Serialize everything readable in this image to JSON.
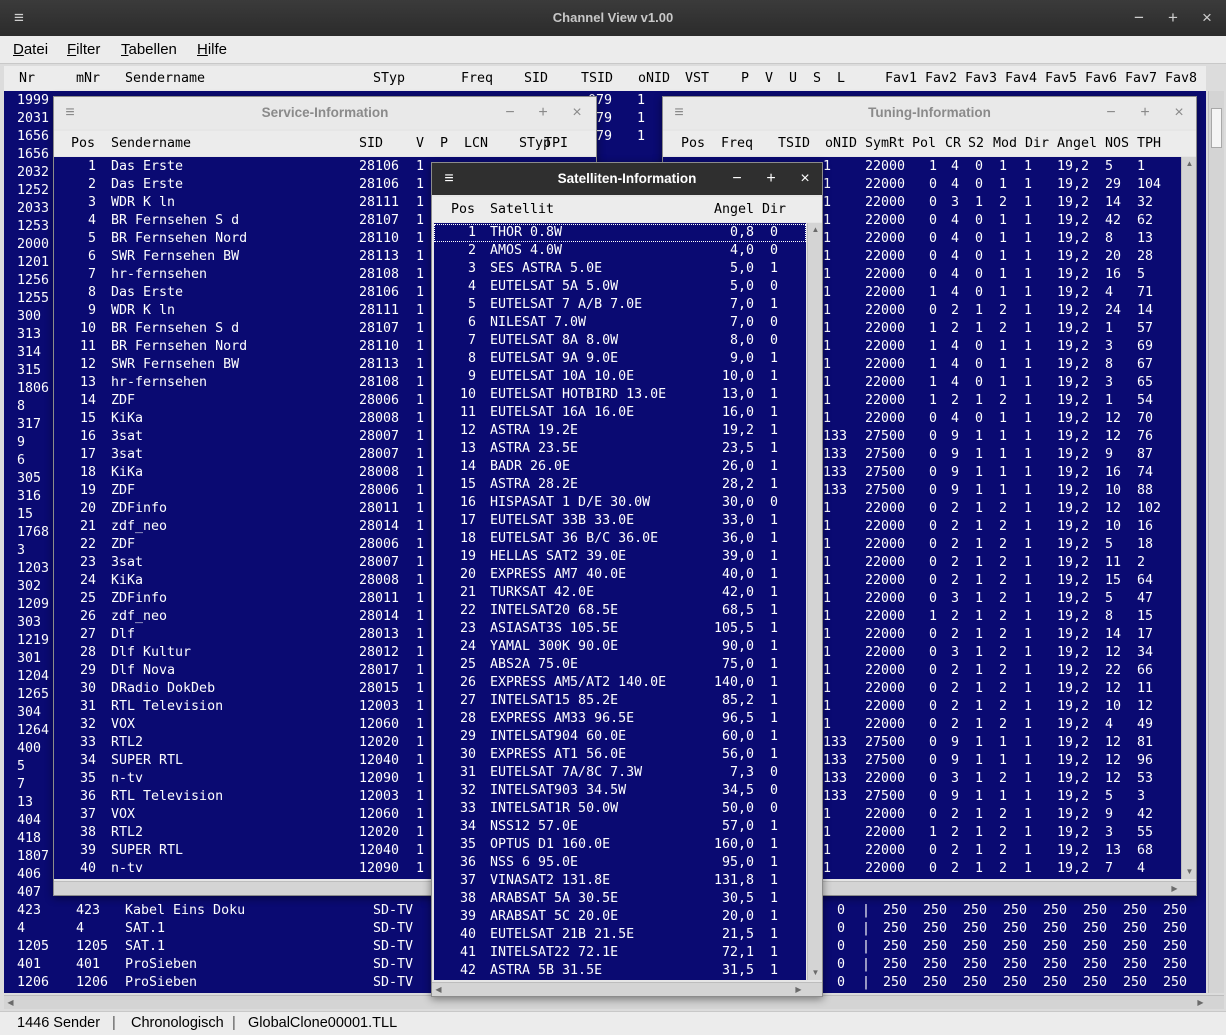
{
  "app": {
    "title": "Channel View v1.00"
  },
  "menu": [
    {
      "label": "Datei",
      "hotkey": "D"
    },
    {
      "label": "Filter",
      "hotkey": "F"
    },
    {
      "label": "Tabellen",
      "hotkey": "T"
    },
    {
      "label": "Hilfe",
      "hotkey": "H"
    }
  ],
  "main": {
    "headers": [
      "Nr",
      "mNr",
      "Sendername",
      "STyp",
      "Freq",
      "SID",
      "TSID",
      "oNID",
      "VST",
      "P",
      "V",
      "U",
      "S",
      "L",
      "Fav1",
      "Fav2",
      "Fav3",
      "Fav4",
      "Fav5",
      "Fav6",
      "Fav7",
      "Fav8"
    ],
    "left_nr": [
      "1999",
      "2031",
      "1656",
      "1656",
      "2032",
      "1252",
      "2033",
      "1253",
      "2000",
      "1201",
      "1256",
      "1255",
      "300",
      "313",
      "314",
      "315",
      "1806",
      "8",
      "317",
      "9",
      "6",
      "305",
      "316",
      "15",
      "1768",
      "3",
      "1203",
      "302",
      "1209",
      "303",
      "1219",
      "301",
      "1204",
      "1265",
      "304",
      "1264",
      "400",
      "5",
      "7",
      "13",
      "404",
      "418",
      "1807",
      "406",
      "407"
    ],
    "tsid_tail": [
      "079",
      "079",
      "079"
    ],
    "onid_tail": [
      "1",
      "1",
      "1"
    ],
    "bottom_rows": [
      {
        "nr": "423",
        "mnr": "423",
        "name": "Kabel Eins Doku",
        "styp": "SD-TV",
        "onid": "0",
        "favs": [
          "250",
          "250",
          "250",
          "250",
          "250",
          "250",
          "250",
          "250"
        ]
      },
      {
        "nr": "4",
        "mnr": "4",
        "name": "SAT.1",
        "styp": "SD-TV",
        "onid": "0",
        "favs": [
          "250",
          "250",
          "250",
          "250",
          "250",
          "250",
          "250",
          "250"
        ]
      },
      {
        "nr": "1205",
        "mnr": "1205",
        "name": "SAT.1",
        "styp": "SD-TV",
        "onid": "0",
        "favs": [
          "250",
          "250",
          "250",
          "250",
          "250",
          "250",
          "250",
          "250"
        ]
      },
      {
        "nr": "401",
        "mnr": "401",
        "name": "ProSieben",
        "styp": "SD-TV",
        "onid": "0",
        "favs": [
          "250",
          "250",
          "250",
          "250",
          "250",
          "250",
          "250",
          "250"
        ]
      },
      {
        "nr": "1206",
        "mnr": "1206",
        "name": "ProSieben",
        "styp": "SD-TV",
        "onid": "0",
        "favs": [
          "250",
          "250",
          "250",
          "250",
          "250",
          "250",
          "250",
          "250"
        ]
      }
    ]
  },
  "service": {
    "title": "Service-Information",
    "headers": [
      "Pos",
      "Sendername",
      "SID",
      "V",
      "P",
      "LCN",
      "STyp",
      "TPI"
    ],
    "rows": [
      [
        "1",
        "Das Erste",
        "28106",
        "1"
      ],
      [
        "2",
        "Das Erste",
        "28106",
        "1"
      ],
      [
        "3",
        "WDR K ln",
        "28111",
        "1"
      ],
      [
        "4",
        "BR Fernsehen S d",
        "28107",
        "1"
      ],
      [
        "5",
        "BR Fernsehen Nord",
        "28110",
        "1"
      ],
      [
        "6",
        "SWR Fernsehen BW",
        "28113",
        "1"
      ],
      [
        "7",
        "hr-fernsehen",
        "28108",
        "1"
      ],
      [
        "8",
        "Das Erste",
        "28106",
        "1"
      ],
      [
        "9",
        "WDR K ln",
        "28111",
        "1"
      ],
      [
        "10",
        "BR Fernsehen S d",
        "28107",
        "1"
      ],
      [
        "11",
        "BR Fernsehen Nord",
        "28110",
        "1"
      ],
      [
        "12",
        "SWR Fernsehen BW",
        "28113",
        "1"
      ],
      [
        "13",
        "hr-fernsehen",
        "28108",
        "1"
      ],
      [
        "14",
        "ZDF",
        "28006",
        "1"
      ],
      [
        "15",
        "KiKa",
        "28008",
        "1"
      ],
      [
        "16",
        "3sat",
        "28007",
        "1"
      ],
      [
        "17",
        "3sat",
        "28007",
        "1"
      ],
      [
        "18",
        "KiKa",
        "28008",
        "1"
      ],
      [
        "19",
        "ZDF",
        "28006",
        "1"
      ],
      [
        "20",
        "ZDFinfo",
        "28011",
        "1"
      ],
      [
        "21",
        "zdf_neo",
        "28014",
        "1"
      ],
      [
        "22",
        "ZDF",
        "28006",
        "1"
      ],
      [
        "23",
        "3sat",
        "28007",
        "1"
      ],
      [
        "24",
        "KiKa",
        "28008",
        "1"
      ],
      [
        "25",
        "ZDFinfo",
        "28011",
        "1"
      ],
      [
        "26",
        "zdf_neo",
        "28014",
        "1"
      ],
      [
        "27",
        "Dlf",
        "28013",
        "1"
      ],
      [
        "28",
        "Dlf Kultur",
        "28012",
        "1"
      ],
      [
        "29",
        "Dlf Nova",
        "28017",
        "1"
      ],
      [
        "30",
        "DRadio DokDeb",
        "28015",
        "1"
      ],
      [
        "31",
        "RTL Television",
        "12003",
        "1"
      ],
      [
        "32",
        "VOX",
        "12060",
        "1"
      ],
      [
        "33",
        "RTL2",
        "12020",
        "1"
      ],
      [
        "34",
        "SUPER RTL",
        "12040",
        "1"
      ],
      [
        "35",
        "n-tv",
        "12090",
        "1"
      ],
      [
        "36",
        "RTL Television",
        "12003",
        "1"
      ],
      [
        "37",
        "VOX",
        "12060",
        "1"
      ],
      [
        "38",
        "RTL2",
        "12020",
        "1"
      ],
      [
        "39",
        "SUPER RTL",
        "12040",
        "1"
      ],
      [
        "40",
        "n-tv",
        "12090",
        "1"
      ]
    ]
  },
  "tuning": {
    "title": "Tuning-Information",
    "headers": [
      "Pos",
      "Freq",
      "TSID",
      "oNID",
      "SymRt",
      "Pol",
      "CR",
      "S2",
      "Mod",
      "Dir",
      "Angel",
      "NOS",
      "TPH"
    ],
    "rows": [
      [
        "1",
        "22000",
        "1",
        "4",
        "0",
        "1",
        "1",
        "19,2",
        "5",
        "1"
      ],
      [
        "1",
        "22000",
        "0",
        "4",
        "0",
        "1",
        "1",
        "19,2",
        "29",
        "104"
      ],
      [
        "1",
        "22000",
        "0",
        "3",
        "1",
        "2",
        "1",
        "19,2",
        "14",
        "32"
      ],
      [
        "1",
        "22000",
        "0",
        "4",
        "0",
        "1",
        "1",
        "19,2",
        "42",
        "62"
      ],
      [
        "1",
        "22000",
        "0",
        "4",
        "0",
        "1",
        "1",
        "19,2",
        "8",
        "13"
      ],
      [
        "1",
        "22000",
        "0",
        "4",
        "0",
        "1",
        "1",
        "19,2",
        "20",
        "28"
      ],
      [
        "1",
        "22000",
        "0",
        "4",
        "0",
        "1",
        "1",
        "19,2",
        "16",
        "5"
      ],
      [
        "1",
        "22000",
        "1",
        "4",
        "0",
        "1",
        "1",
        "19,2",
        "4",
        "71"
      ],
      [
        "1",
        "22000",
        "0",
        "2",
        "1",
        "2",
        "1",
        "19,2",
        "24",
        "14"
      ],
      [
        "1",
        "22000",
        "1",
        "2",
        "1",
        "2",
        "1",
        "19,2",
        "1",
        "57"
      ],
      [
        "1",
        "22000",
        "1",
        "4",
        "0",
        "1",
        "1",
        "19,2",
        "3",
        "69"
      ],
      [
        "1",
        "22000",
        "1",
        "4",
        "0",
        "1",
        "1",
        "19,2",
        "8",
        "67"
      ],
      [
        "1",
        "22000",
        "1",
        "4",
        "0",
        "1",
        "1",
        "19,2",
        "3",
        "65"
      ],
      [
        "1",
        "22000",
        "1",
        "2",
        "1",
        "2",
        "1",
        "19,2",
        "1",
        "54"
      ],
      [
        "1",
        "22000",
        "0",
        "4",
        "0",
        "1",
        "1",
        "19,2",
        "12",
        "70"
      ],
      [
        "133",
        "27500",
        "0",
        "9",
        "1",
        "1",
        "1",
        "19,2",
        "12",
        "76"
      ],
      [
        "133",
        "27500",
        "0",
        "9",
        "1",
        "1",
        "1",
        "19,2",
        "9",
        "87"
      ],
      [
        "133",
        "27500",
        "0",
        "9",
        "1",
        "1",
        "1",
        "19,2",
        "16",
        "74"
      ],
      [
        "133",
        "27500",
        "0",
        "9",
        "1",
        "1",
        "1",
        "19,2",
        "10",
        "88"
      ],
      [
        "1",
        "22000",
        "0",
        "2",
        "1",
        "2",
        "1",
        "19,2",
        "12",
        "102"
      ],
      [
        "1",
        "22000",
        "0",
        "2",
        "1",
        "2",
        "1",
        "19,2",
        "10",
        "16"
      ],
      [
        "1",
        "22000",
        "0",
        "2",
        "1",
        "2",
        "1",
        "19,2",
        "5",
        "18"
      ],
      [
        "1",
        "22000",
        "0",
        "2",
        "1",
        "2",
        "1",
        "19,2",
        "11",
        "2"
      ],
      [
        "1",
        "22000",
        "0",
        "2",
        "1",
        "2",
        "1",
        "19,2",
        "15",
        "64"
      ],
      [
        "1",
        "22000",
        "0",
        "3",
        "1",
        "2",
        "1",
        "19,2",
        "5",
        "47"
      ],
      [
        "1",
        "22000",
        "1",
        "2",
        "1",
        "2",
        "1",
        "19,2",
        "8",
        "15"
      ],
      [
        "1",
        "22000",
        "0",
        "2",
        "1",
        "2",
        "1",
        "19,2",
        "14",
        "17"
      ],
      [
        "1",
        "22000",
        "0",
        "3",
        "1",
        "2",
        "1",
        "19,2",
        "12",
        "34"
      ],
      [
        "1",
        "22000",
        "0",
        "2",
        "1",
        "2",
        "1",
        "19,2",
        "22",
        "66"
      ],
      [
        "1",
        "22000",
        "0",
        "2",
        "1",
        "2",
        "1",
        "19,2",
        "12",
        "11"
      ],
      [
        "1",
        "22000",
        "0",
        "2",
        "1",
        "2",
        "1",
        "19,2",
        "10",
        "12"
      ],
      [
        "1",
        "22000",
        "0",
        "2",
        "1",
        "2",
        "1",
        "19,2",
        "4",
        "49"
      ],
      [
        "133",
        "27500",
        "0",
        "9",
        "1",
        "1",
        "1",
        "19,2",
        "12",
        "81"
      ],
      [
        "133",
        "27500",
        "0",
        "9",
        "1",
        "1",
        "1",
        "19,2",
        "12",
        "96"
      ],
      [
        "133",
        "22000",
        "0",
        "3",
        "1",
        "2",
        "1",
        "19,2",
        "12",
        "53"
      ],
      [
        "133",
        "27500",
        "0",
        "9",
        "1",
        "1",
        "1",
        "19,2",
        "5",
        "3"
      ],
      [
        "1",
        "22000",
        "0",
        "2",
        "1",
        "2",
        "1",
        "19,2",
        "9",
        "42"
      ],
      [
        "1",
        "22000",
        "1",
        "2",
        "1",
        "2",
        "1",
        "19,2",
        "3",
        "55"
      ],
      [
        "1",
        "22000",
        "0",
        "2",
        "1",
        "2",
        "1",
        "19,2",
        "13",
        "68"
      ],
      [
        "1",
        "22000",
        "0",
        "2",
        "1",
        "2",
        "1",
        "19,2",
        "7",
        "4"
      ]
    ]
  },
  "satellites": {
    "title": "Satelliten-Information",
    "headers": [
      "Pos",
      "Satellit",
      "Angel",
      "Dir"
    ],
    "rows": [
      [
        "1",
        "THOR 0.8W",
        "0,8",
        "0"
      ],
      [
        "2",
        "AMOS 4.0W",
        "4,0",
        "0"
      ],
      [
        "3",
        "SES ASTRA 5.0E",
        "5,0",
        "1"
      ],
      [
        "4",
        "EUTELSAT 5A 5.0W",
        "5,0",
        "0"
      ],
      [
        "5",
        "EUTELSAT 7 A/B 7.0E",
        "7,0",
        "1"
      ],
      [
        "6",
        "NILESAT 7.0W",
        "7,0",
        "0"
      ],
      [
        "7",
        "EUTELSAT 8A 8.0W",
        "8,0",
        "0"
      ],
      [
        "8",
        "EUTELSAT 9A 9.0E",
        "9,0",
        "1"
      ],
      [
        "9",
        "EUTELSAT 10A 10.0E",
        "10,0",
        "1"
      ],
      [
        "10",
        "EUTELSAT HOTBIRD 13.0E",
        "13,0",
        "1"
      ],
      [
        "11",
        "EUTELSAT 16A 16.0E",
        "16,0",
        "1"
      ],
      [
        "12",
        "ASTRA 19.2E",
        "19,2",
        "1"
      ],
      [
        "13",
        "ASTRA 23.5E",
        "23,5",
        "1"
      ],
      [
        "14",
        "BADR 26.0E",
        "26,0",
        "1"
      ],
      [
        "15",
        "ASTRA 28.2E",
        "28,2",
        "1"
      ],
      [
        "16",
        "HISPASAT 1 D/E 30.0W",
        "30,0",
        "0"
      ],
      [
        "17",
        "EUTELSAT 33B 33.0E",
        "33,0",
        "1"
      ],
      [
        "18",
        "EUTELSAT 36 B/C 36.0E",
        "36,0",
        "1"
      ],
      [
        "19",
        "HELLAS SAT2 39.0E",
        "39,0",
        "1"
      ],
      [
        "20",
        "EXPRESS AM7 40.0E",
        "40,0",
        "1"
      ],
      [
        "21",
        "TURKSAT 42.0E",
        "42,0",
        "1"
      ],
      [
        "22",
        "INTELSAT20 68.5E",
        "68,5",
        "1"
      ],
      [
        "23",
        "ASIASAT3S 105.5E",
        "105,5",
        "1"
      ],
      [
        "24",
        "YAMAL 300K 90.0E",
        "90,0",
        "1"
      ],
      [
        "25",
        "ABS2A 75.0E",
        "75,0",
        "1"
      ],
      [
        "26",
        "EXPRESS AM5/AT2 140.0E",
        "140,0",
        "1"
      ],
      [
        "27",
        "INTELSAT15 85.2E",
        "85,2",
        "1"
      ],
      [
        "28",
        "EXPRESS AM33 96.5E",
        "96,5",
        "1"
      ],
      [
        "29",
        "INTELSAT904 60.0E",
        "60,0",
        "1"
      ],
      [
        "30",
        "EXPRESS AT1 56.0E",
        "56,0",
        "1"
      ],
      [
        "31",
        "EUTELSAT 7A/8C 7.3W",
        "7,3",
        "0"
      ],
      [
        "32",
        "INTELSAT903 34.5W",
        "34,5",
        "0"
      ],
      [
        "33",
        "INTELSAT1R 50.0W",
        "50,0",
        "0"
      ],
      [
        "34",
        "NSS12 57.0E",
        "57,0",
        "1"
      ],
      [
        "35",
        "OPTUS D1 160.0E",
        "160,0",
        "1"
      ],
      [
        "36",
        "NSS 6 95.0E",
        "95,0",
        "1"
      ],
      [
        "37",
        "VINASAT2 131.8E",
        "131,8",
        "1"
      ],
      [
        "38",
        "ARABSAT 5A 30.5E",
        "30,5",
        "1"
      ],
      [
        "39",
        "ARABSAT 5C 20.0E",
        "20,0",
        "1"
      ],
      [
        "40",
        "EUTELSAT 21B 21.5E",
        "21,5",
        "1"
      ],
      [
        "41",
        "INTELSAT22 72.1E",
        "72,1",
        "1"
      ],
      [
        "42",
        "ASTRA 5B 31.5E",
        "31,5",
        "1"
      ]
    ]
  },
  "status": {
    "count": "1446 Sender",
    "sort": "Chronologisch",
    "file": "GlobalClone00001.TLL"
  },
  "window_buttons": {
    "menu": "≡",
    "minimize": "−",
    "maximize": "+",
    "close": "×"
  },
  "scroll_arrows": {
    "up": "▲",
    "down": "▼",
    "left": "◀",
    "right": "▶"
  }
}
